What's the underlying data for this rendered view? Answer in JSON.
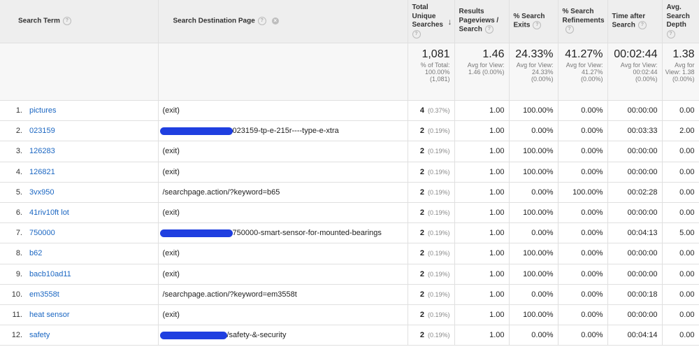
{
  "headers": {
    "search_term": "Search Term",
    "destination": "Search Destination Page",
    "unique_searches": "Total Unique Searches",
    "results_pageviews": "Results Pageviews / Search",
    "search_exits": "% Search Exits",
    "search_refinements": "% Search Refinements",
    "time_after": "Time after Search",
    "search_depth": "Avg. Search Depth",
    "help_icon": "?",
    "remove_icon": "×",
    "sort_icon": "↓"
  },
  "totals": {
    "unique_searches": {
      "value": "1,081",
      "sub": "% of Total: 100.00% (1,081)"
    },
    "results_pageviews": {
      "value": "1.46",
      "sub": "Avg for View: 1.46 (0.00%)"
    },
    "search_exits": {
      "value": "24.33%",
      "sub": "Avg for View: 24.33% (0.00%)"
    },
    "search_refinements": {
      "value": "41.27%",
      "sub": "Avg for View: 41.27% (0.00%)"
    },
    "time_after": {
      "value": "00:02:44",
      "sub": "Avg for View: 00:02:44 (0.00%)"
    },
    "search_depth": {
      "value": "1.38",
      "sub": "Avg for View: 1.38 (0.00%)"
    }
  },
  "rows": [
    {
      "idx": "1.",
      "term": "pictures",
      "dest": "(exit)",
      "count": "4",
      "pct": "(0.37%)",
      "pv": "1.00",
      "exits": "100.00%",
      "ref": "0.00%",
      "time": "00:00:00",
      "depth": "0.00"
    },
    {
      "idx": "2.",
      "term": "023159",
      "dest": "023159-tp-e-215r----type-e-xtra",
      "count": "2",
      "pct": "(0.19%)",
      "pv": "1.00",
      "exits": "0.00%",
      "ref": "0.00%",
      "time": "00:03:33",
      "depth": "2.00"
    },
    {
      "idx": "3.",
      "term": "126283",
      "dest": "(exit)",
      "count": "2",
      "pct": "(0.19%)",
      "pv": "1.00",
      "exits": "100.00%",
      "ref": "0.00%",
      "time": "00:00:00",
      "depth": "0.00"
    },
    {
      "idx": "4.",
      "term": "126821",
      "dest": "(exit)",
      "count": "2",
      "pct": "(0.19%)",
      "pv": "1.00",
      "exits": "100.00%",
      "ref": "0.00%",
      "time": "00:00:00",
      "depth": "0.00"
    },
    {
      "idx": "5.",
      "term": "3vx950",
      "dest": "/searchpage.action/?keyword=b65",
      "count": "2",
      "pct": "(0.19%)",
      "pv": "1.00",
      "exits": "0.00%",
      "ref": "100.00%",
      "time": "00:02:28",
      "depth": "0.00"
    },
    {
      "idx": "6.",
      "term": "41riv10ft lot",
      "dest": "(exit)",
      "count": "2",
      "pct": "(0.19%)",
      "pv": "1.00",
      "exits": "100.00%",
      "ref": "0.00%",
      "time": "00:00:00",
      "depth": "0.00"
    },
    {
      "idx": "7.",
      "term": "750000",
      "dest": "750000-smart-sensor-for-mounted-bearings",
      "count": "2",
      "pct": "(0.19%)",
      "pv": "1.00",
      "exits": "0.00%",
      "ref": "0.00%",
      "time": "00:04:13",
      "depth": "5.00"
    },
    {
      "idx": "8.",
      "term": "b62",
      "dest": "(exit)",
      "count": "2",
      "pct": "(0.19%)",
      "pv": "1.00",
      "exits": "100.00%",
      "ref": "0.00%",
      "time": "00:00:00",
      "depth": "0.00"
    },
    {
      "idx": "9.",
      "term": "bacb10ad11",
      "dest": "(exit)",
      "count": "2",
      "pct": "(0.19%)",
      "pv": "1.00",
      "exits": "100.00%",
      "ref": "0.00%",
      "time": "00:00:00",
      "depth": "0.00"
    },
    {
      "idx": "10.",
      "term": "em3558t",
      "dest": "/searchpage.action/?keyword=em3558t",
      "count": "2",
      "pct": "(0.19%)",
      "pv": "1.00",
      "exits": "0.00%",
      "ref": "0.00%",
      "time": "00:00:18",
      "depth": "0.00"
    },
    {
      "idx": "11.",
      "term": "heat sensor",
      "dest": "(exit)",
      "count": "2",
      "pct": "(0.19%)",
      "pv": "1.00",
      "exits": "100.00%",
      "ref": "0.00%",
      "time": "00:00:00",
      "depth": "0.00"
    },
    {
      "idx": "12.",
      "term": "safety",
      "dest": "/safety-&-security",
      "count": "2",
      "pct": "(0.19%)",
      "pv": "1.00",
      "exits": "0.00%",
      "ref": "0.00%",
      "time": "00:04:14",
      "depth": "0.00"
    }
  ],
  "colors": {
    "link": "#1a66c2",
    "redaction": "#1f3fe0",
    "header_bg": "#eeeeee"
  }
}
